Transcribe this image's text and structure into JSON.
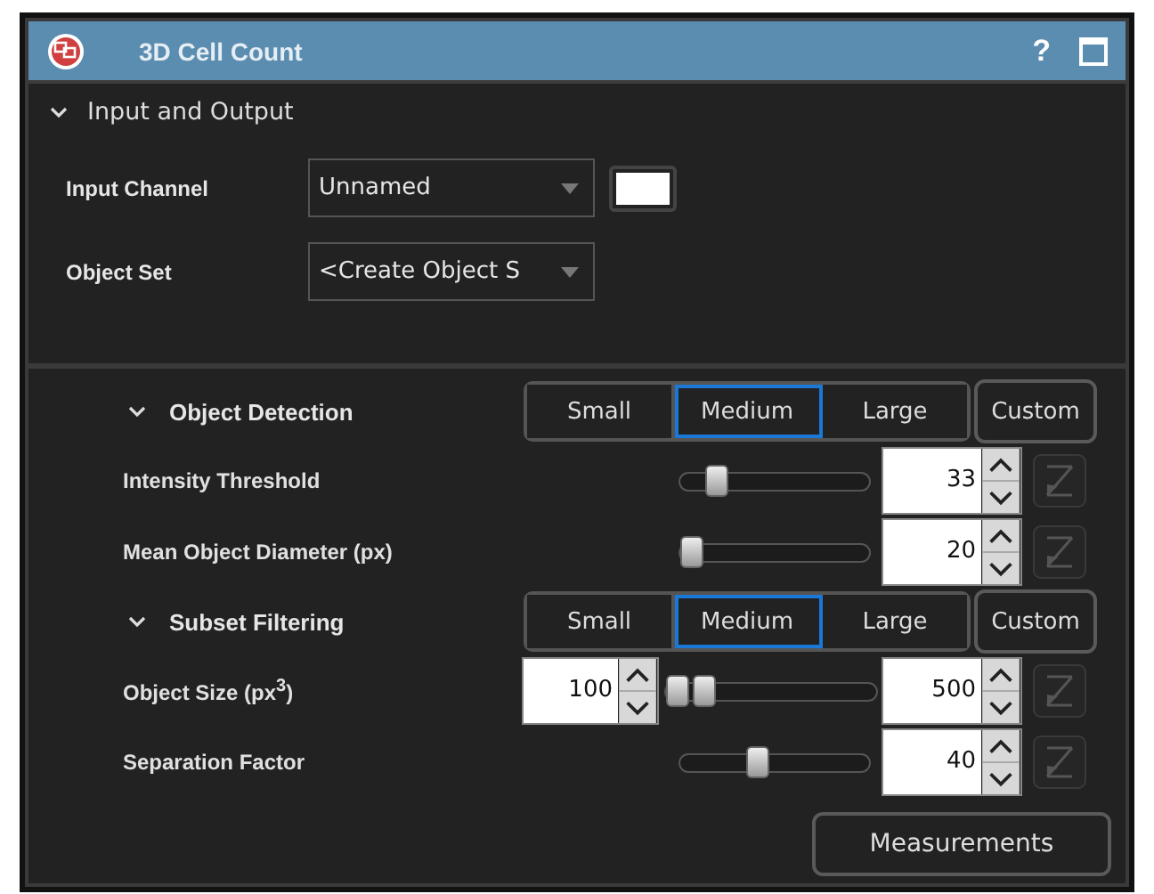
{
  "window": {
    "title": "3D Cell Count",
    "help": "?"
  },
  "input_output": {
    "title": "Input and Output",
    "expanded": true,
    "fields": [
      {
        "label": "Input Channel",
        "value": "Unnamed",
        "color": "#ffffff"
      },
      {
        "label": "Object Set",
        "value": "<Create Object S"
      }
    ]
  },
  "sections": [
    {
      "title": "Object Detection",
      "expanded": true,
      "presets": [
        {
          "label": "Small",
          "selected": false
        },
        {
          "label": "Medium",
          "selected": true
        },
        {
          "label": "Large",
          "selected": false
        }
      ],
      "custom": "Custom",
      "params": [
        {
          "kind": "slider",
          "label": "Intensity Threshold",
          "level": 0.15,
          "value": "33"
        },
        {
          "kind": "slider",
          "label": "Mean Object Diameter (px)",
          "level": 0.0,
          "value": "20"
        }
      ]
    },
    {
      "title": "Subset Filtering",
      "expanded": true,
      "presets": [
        {
          "label": "Small",
          "selected": false
        },
        {
          "label": "Medium",
          "selected": true
        },
        {
          "label": "Large",
          "selected": false
        }
      ],
      "custom": "Custom",
      "params": [
        {
          "kind": "range",
          "label": "Object Size (px$^{3}$)",
          "min_value": "100",
          "low": {
            "level": 0.0
          },
          "high": {
            "level": 0.14
          },
          "value": "500"
        },
        {
          "kind": "slider",
          "label": "Separation Factor",
          "level": 0.4,
          "value": "40"
        }
      ]
    }
  ],
  "buttons": [
    "Measurements"
  ]
}
